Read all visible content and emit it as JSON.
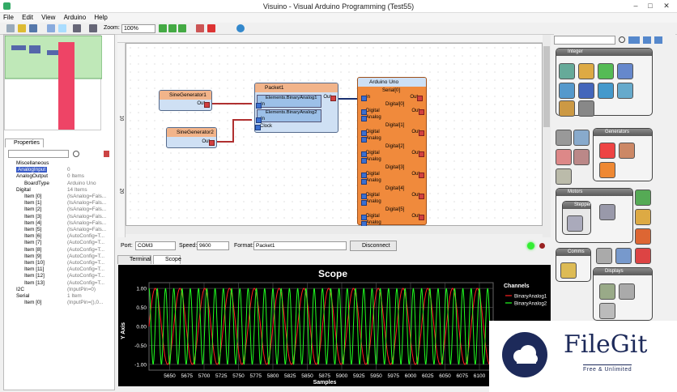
{
  "window": {
    "title": "Visuino - Visual Arduino Programming (Test55)"
  },
  "menu": [
    "File",
    "Edit",
    "View",
    "Arduino",
    "Help"
  ],
  "toolbar": {
    "zoom_label": "Zoom:",
    "zoom_value": "100%"
  },
  "properties": {
    "tab": "Properties",
    "rows": [
      {
        "k": "Miscellaneous",
        "v": "",
        "indent": 0
      },
      {
        "k": "AnalogInput",
        "v": "0",
        "indent": 0,
        "selected": true
      },
      {
        "k": "AnalogOutput",
        "v": "0 Items",
        "indent": 0
      },
      {
        "k": "BoardType",
        "v": "Arduino Uno",
        "indent": 1
      },
      {
        "k": "Digital",
        "v": "14 Items",
        "indent": 0
      },
      {
        "k": "Item [0]",
        "v": "(IsAnalog=Fals...",
        "indent": 1
      },
      {
        "k": "Item [1]",
        "v": "(IsAnalog=Fals...",
        "indent": 1
      },
      {
        "k": "Item [2]",
        "v": "(IsAnalog=Fals...",
        "indent": 1
      },
      {
        "k": "Item [3]",
        "v": "(IsAnalog=Fals...",
        "indent": 1
      },
      {
        "k": "Item [4]",
        "v": "(IsAnalog=Fals...",
        "indent": 1
      },
      {
        "k": "Item [5]",
        "v": "(IsAnalog=Fals...",
        "indent": 1
      },
      {
        "k": "Item [6]",
        "v": "(AutoConfig=T...",
        "indent": 1
      },
      {
        "k": "Item [7]",
        "v": "(AutoConfig=T...",
        "indent": 1
      },
      {
        "k": "Item [8]",
        "v": "(AutoConfig=T...",
        "indent": 1
      },
      {
        "k": "Item [9]",
        "v": "(AutoConfig=T...",
        "indent": 1
      },
      {
        "k": "Item [10]",
        "v": "(AutoConfig=T...",
        "indent": 1
      },
      {
        "k": "Item [11]",
        "v": "(AutoConfig=T...",
        "indent": 1
      },
      {
        "k": "Item [12]",
        "v": "(AutoConfig=T...",
        "indent": 1
      },
      {
        "k": "Item [13]",
        "v": "(AutoConfig=T...",
        "indent": 1
      },
      {
        "k": "I2C",
        "v": "(InputPin=0)",
        "indent": 0
      },
      {
        "k": "Serial",
        "v": "1 Item",
        "indent": 0
      },
      {
        "k": "Item [0]",
        "v": "(InputPin=(),0...",
        "indent": 1
      }
    ]
  },
  "canvas": {
    "ruler_marks": [
      "10",
      "20"
    ],
    "sine1": {
      "title": "SineGenerator1",
      "out": "Out"
    },
    "sine2": {
      "title": "SineGenerator2",
      "out": "Out"
    },
    "packet": {
      "title": "Packet1",
      "el1": "Elements.BinaryAnalog1",
      "el2": "Elements.BinaryAnalog2",
      "in": "In",
      "clock": "Clock",
      "out": "Out"
    },
    "arduino": {
      "title": "Arduino Uno",
      "serial": "Serial[0]",
      "in": "In",
      "out": "Out",
      "slots": [
        {
          "name": "Digital[0]",
          "a": "Digital",
          "b": "Analog"
        },
        {
          "name": "Digital[1]",
          "a": "Digital",
          "b": "Analog"
        },
        {
          "name": "Digital[2]",
          "a": "Digital",
          "b": "Analog"
        },
        {
          "name": "Digital[3]",
          "a": "Digital",
          "b": "Analog"
        },
        {
          "name": "Digital[4]",
          "a": "Digital",
          "b": "Analog"
        },
        {
          "name": "Digital[5]",
          "a": "Digital",
          "b": "Analog"
        }
      ]
    }
  },
  "port": {
    "port_label": "Port:",
    "port_value": "COM3",
    "speed_label": "Speed:",
    "speed_value": "9600",
    "format_label": "Format:",
    "format_value": "Packet1",
    "disconnect": "Disconnect"
  },
  "tabs": [
    "Terminal",
    "Scope"
  ],
  "right_panel": {
    "groups": [
      "Integer",
      "Generators",
      "Motors",
      "Stepper",
      "Comms",
      "Displays"
    ]
  },
  "watermark": {
    "name": "FileGit",
    "tag": "Free & Unlimited"
  },
  "chart_data": {
    "type": "line",
    "title": "Scope",
    "xlabel": "Samples",
    "ylabel": "Y Axis",
    "legend_title": "Channels",
    "legend_position": "right",
    "xlim": [
      5620,
      6120
    ],
    "ylim": [
      -1.15,
      1.15
    ],
    "x_ticks": [
      5650,
      5700,
      5750,
      5800,
      5850,
      5900,
      5950,
      6000,
      6050,
      6100
    ],
    "x_tick_labels": [
      "5650",
      "5700",
      "5750",
      "5800",
      "5850",
      "5900",
      "5950",
      "6000",
      "6050",
      "6100"
    ],
    "x_minor_labels": [
      "5675",
      "5725",
      "5775",
      "5825",
      "5875",
      "5925",
      "5975",
      "6025",
      "6075"
    ],
    "y_ticks": [
      -1,
      -0.5,
      0,
      0.5,
      1
    ],
    "y_tick_labels": [
      "-1.00",
      "-0.50",
      "0.00",
      "0.50",
      "1.00"
    ],
    "series": [
      {
        "name": "BinaryAnalog1",
        "color": "#ff2020",
        "amplitude": 1.0,
        "period": 36,
        "phase": 0
      },
      {
        "name": "BinaryAnalog2",
        "color": "#20ff20",
        "amplitude": 1.0,
        "period": 12,
        "phase": 3
      }
    ],
    "grid": true
  }
}
